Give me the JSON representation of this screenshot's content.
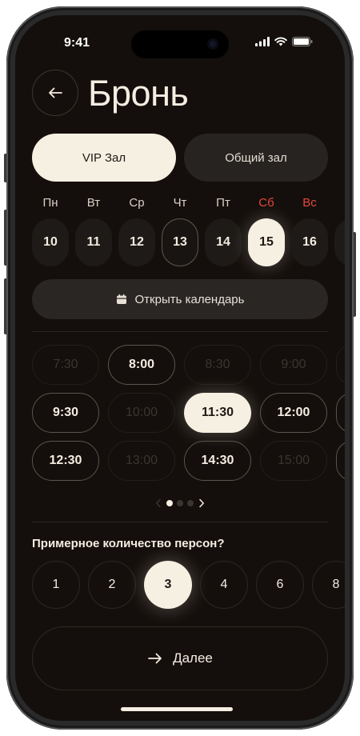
{
  "status_bar": {
    "time": "9:41"
  },
  "header": {
    "title": "Бронь"
  },
  "hall_tabs": [
    {
      "label": "VIP Зал",
      "active": true
    },
    {
      "label": "Общий зал",
      "active": false
    }
  ],
  "days": [
    {
      "name": "Пн",
      "num": "10",
      "state": "normal",
      "weekend": false
    },
    {
      "name": "Вт",
      "num": "11",
      "state": "normal",
      "weekend": false
    },
    {
      "name": "Ср",
      "num": "12",
      "state": "normal",
      "weekend": false
    },
    {
      "name": "Чт",
      "num": "13",
      "state": "outlined",
      "weekend": false
    },
    {
      "name": "Пт",
      "num": "14",
      "state": "normal",
      "weekend": false
    },
    {
      "name": "Сб",
      "num": "15",
      "state": "selected",
      "weekend": true
    },
    {
      "name": "Вс",
      "num": "16",
      "state": "normal",
      "weekend": true
    }
  ],
  "calendar_button": {
    "label": "Открыть календарь",
    "icon": "calendar-icon"
  },
  "time_slots": [
    [
      {
        "time": "7:30",
        "state": "disabled"
      },
      {
        "time": "8:00",
        "state": "available"
      },
      {
        "time": "8:30",
        "state": "disabled"
      },
      {
        "time": "9:00",
        "state": "disabled"
      }
    ],
    [
      {
        "time": "9:30",
        "state": "available"
      },
      {
        "time": "10:00",
        "state": "disabled"
      },
      {
        "time": "11:30",
        "state": "selected"
      },
      {
        "time": "12:00",
        "state": "available"
      }
    ],
    [
      {
        "time": "12:30",
        "state": "available"
      },
      {
        "time": "13:00",
        "state": "disabled"
      },
      {
        "time": "14:30",
        "state": "available"
      },
      {
        "time": "15:00",
        "state": "disabled"
      }
    ]
  ],
  "pager": {
    "pages": 3,
    "active": 1
  },
  "persons": {
    "question": "Примерное количество персон?",
    "options": [
      {
        "label": "1",
        "selected": false
      },
      {
        "label": "2",
        "selected": false
      },
      {
        "label": "3",
        "selected": true
      },
      {
        "label": "4",
        "selected": false
      },
      {
        "label": "6",
        "selected": false
      },
      {
        "label": "8",
        "selected": false
      }
    ]
  },
  "next_button": {
    "label": "Далее"
  },
  "colors": {
    "background": "#140f0c",
    "accent": "#f6f0e3",
    "weekend": "#e5483d"
  }
}
